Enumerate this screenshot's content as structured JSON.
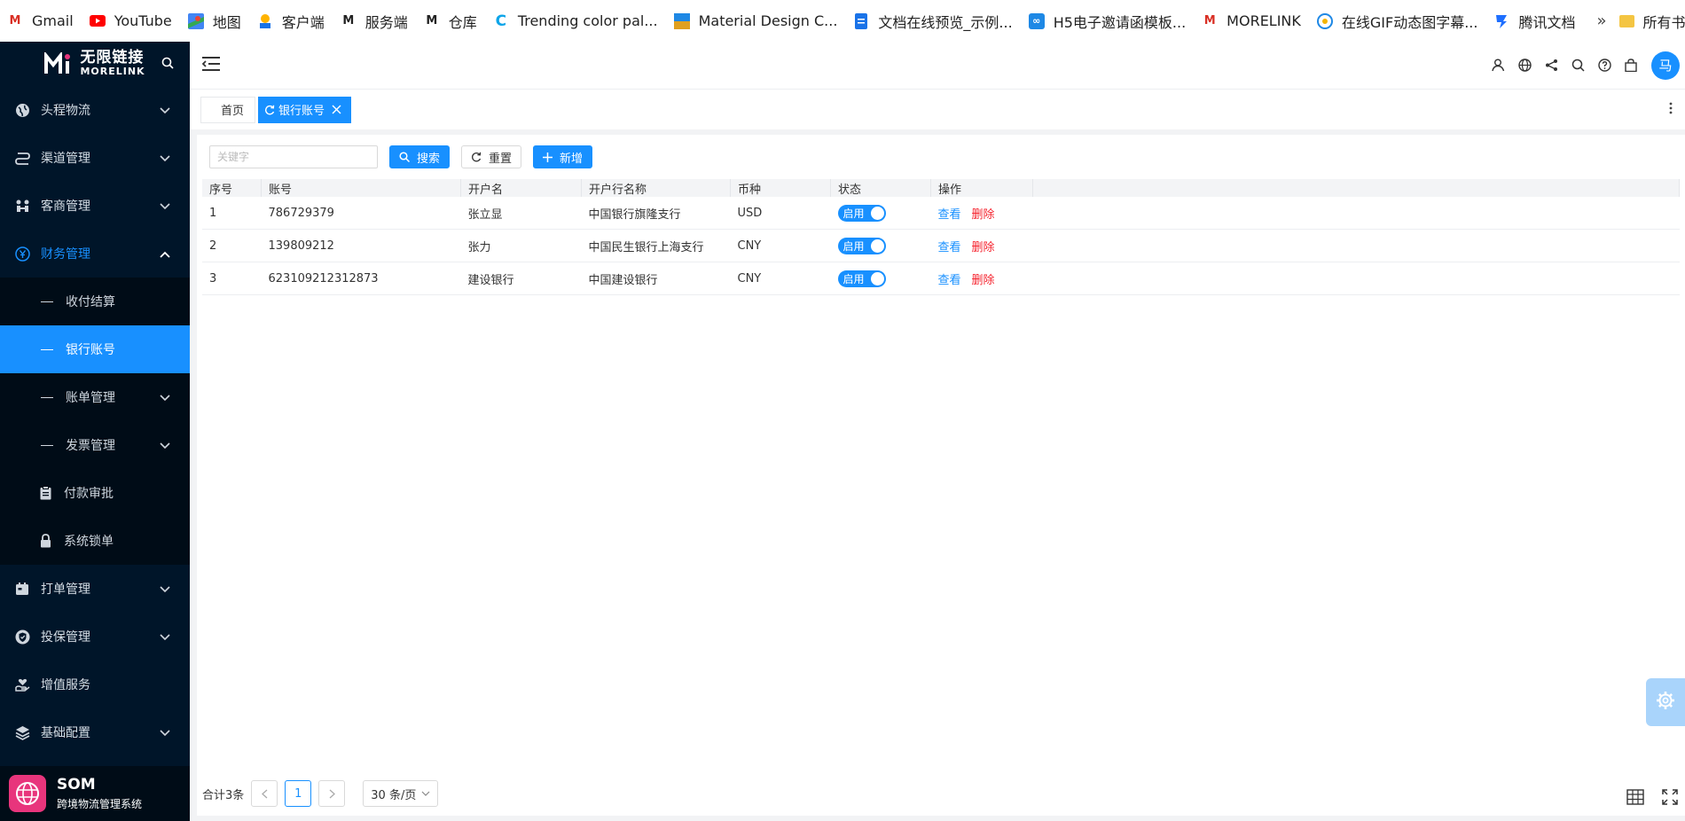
{
  "bookmarks": [
    {
      "label": "Gmail",
      "icon": "gmail-icon",
      "color": "#d93025"
    },
    {
      "label": "YouTube",
      "icon": "youtube-icon",
      "color": "#ff0000"
    },
    {
      "label": "地图",
      "icon": "maps-icon",
      "color": "#4285f4"
    },
    {
      "label": "客户端",
      "icon": "client-icon",
      "color": "#1a73e8"
    },
    {
      "label": "服务端",
      "icon": "morelink-icon",
      "color": "#222222"
    },
    {
      "label": "仓库",
      "icon": "morelink-icon",
      "color": "#222222"
    },
    {
      "label": "Trending color pal...",
      "icon": "coolors-icon",
      "color": "#0ea5e9"
    },
    {
      "label": "Material Design C...",
      "icon": "material-icon",
      "color": "#e0a020"
    },
    {
      "label": "文档在线预览_示例...",
      "icon": "doc-icon",
      "color": "#1a73e8"
    },
    {
      "label": "H5电子邀请函模板...",
      "icon": "h5-icon",
      "color": "#1e88e5"
    },
    {
      "label": "MORELINK",
      "icon": "gmail-icon",
      "color": "#d93025"
    },
    {
      "label": "在线GIF动态图字幕...",
      "icon": "gif-icon",
      "color": "#1e88e5"
    },
    {
      "label": "腾讯文档",
      "icon": "tencent-doc-icon",
      "color": "#1e6fff"
    }
  ],
  "bookmarks_more": "»",
  "bookmarks_all": "所有书签",
  "logo": {
    "cn": "无限链接",
    "en": "MORELINK"
  },
  "sidebar": {
    "items_top": [
      {
        "label": "头程物流"
      },
      {
        "label": "渠道管理"
      },
      {
        "label": "客商管理"
      },
      {
        "label": "财务管理"
      }
    ],
    "finance_sub": [
      {
        "label": "收付结算"
      },
      {
        "label": "银行账号"
      },
      {
        "label": "账单管理"
      },
      {
        "label": "发票管理"
      },
      {
        "label": "付款审批"
      },
      {
        "label": "系统锁单"
      }
    ],
    "items_bottom": [
      {
        "label": "打单管理"
      },
      {
        "label": "投保管理"
      },
      {
        "label": "增值服务"
      },
      {
        "label": "基础配置"
      }
    ],
    "footer_title": "SOM",
    "footer_sub": "跨境物流管理系统"
  },
  "header": {
    "avatar": "马"
  },
  "tabs": {
    "home": "首页",
    "active": "银行账号"
  },
  "toolbar": {
    "search_placeholder": "关键字",
    "search_value": "",
    "search_label": "搜索",
    "reset_label": "重置",
    "add_label": "新增"
  },
  "table": {
    "columns": [
      "序号",
      "账号",
      "开户名",
      "开户行名称",
      "币种",
      "状态",
      "操作"
    ],
    "rows": [
      {
        "index": "1",
        "account": "786729379",
        "holder": "张立显",
        "bank": "中国银行旗隆支行",
        "currency": "USD",
        "status": "启用"
      },
      {
        "index": "2",
        "account": "139809212",
        "holder": "张力",
        "bank": "中国民生银行上海支行",
        "currency": "CNY",
        "status": "启用"
      },
      {
        "index": "3",
        "account": "623109212312873",
        "holder": "建设银行",
        "bank": "中国建设银行",
        "currency": "CNY",
        "status": "启用"
      }
    ],
    "view_label": "查看",
    "delete_label": "删除"
  },
  "pager": {
    "total": "合计3条",
    "current_page": "1",
    "page_size": "30 条/页"
  },
  "colors": {
    "primary": "#1890ff",
    "danger": "#f5222d",
    "sidebar_bg": "#001529",
    "som_logo": "#e8357c"
  }
}
